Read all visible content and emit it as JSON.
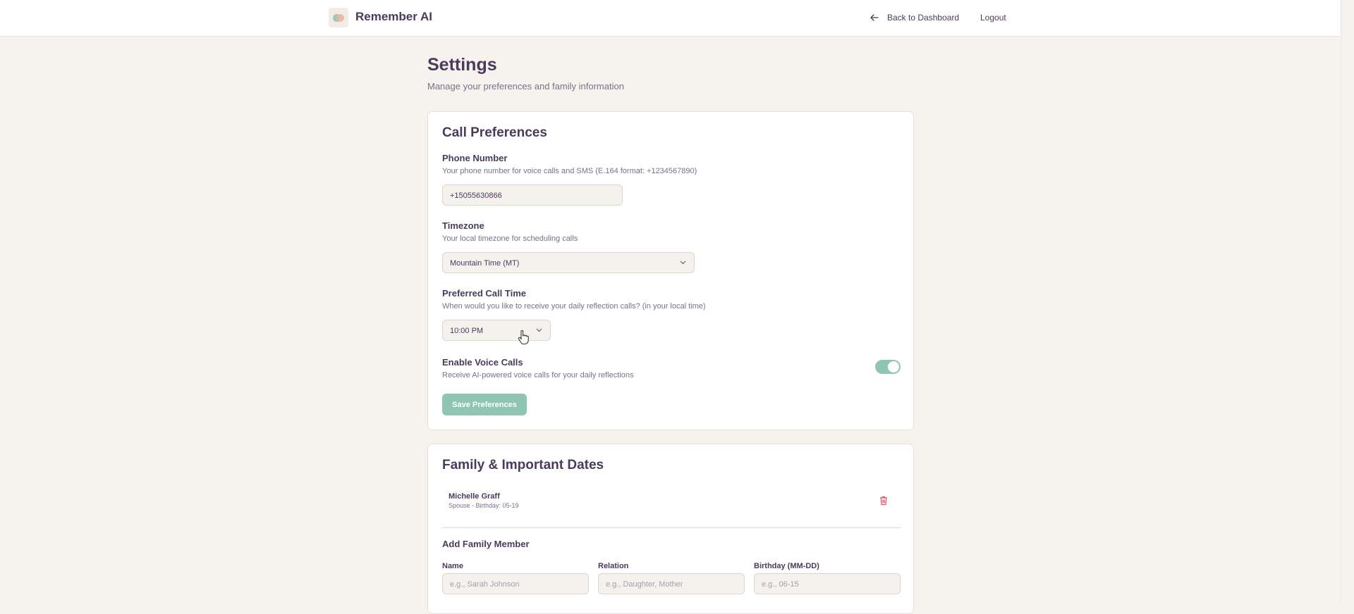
{
  "header": {
    "brand": "Remember AI",
    "back_label": "Back to Dashboard",
    "logout_label": "Logout"
  },
  "page": {
    "title": "Settings",
    "subtitle": "Manage your preferences and family information"
  },
  "call_preferences": {
    "title": "Call Preferences",
    "phone": {
      "label": "Phone Number",
      "help": "Your phone number for voice calls and SMS (E.164 format: +1234567890)",
      "value": "+15055630866"
    },
    "timezone": {
      "label": "Timezone",
      "help": "Your local timezone for scheduling calls",
      "value": "Mountain Time (MT)"
    },
    "call_time": {
      "label": "Preferred Call Time",
      "help": "When would you like to receive your daily reflection calls? (in your local time)",
      "value": "10:00 PM"
    },
    "voice_calls": {
      "label": "Enable Voice Calls",
      "help": "Receive AI-powered voice calls for your daily reflections",
      "enabled": true
    },
    "save_label": "Save Preferences"
  },
  "family": {
    "title": "Family & Important Dates",
    "members": [
      {
        "name": "Michelle Graff",
        "detail": "Spouse - Birthday: 05-19"
      }
    ],
    "add_title": "Add Family Member",
    "fields": {
      "name_label": "Name",
      "name_placeholder": "e.g., Sarah Johnson",
      "relation_label": "Relation",
      "relation_placeholder": "e.g., Daughter, Mother",
      "birthday_label": "Birthday (MM-DD)",
      "birthday_placeholder": "e.g., 06-15"
    }
  },
  "colors": {
    "accent": "#8ec6b3",
    "text": "#4a3a5c",
    "background": "#f6f3ee",
    "danger": "#e0566a"
  },
  "icons": [
    "arrow-left-icon",
    "chevron-down-icon",
    "trash-icon",
    "pointer-cursor-icon"
  ]
}
